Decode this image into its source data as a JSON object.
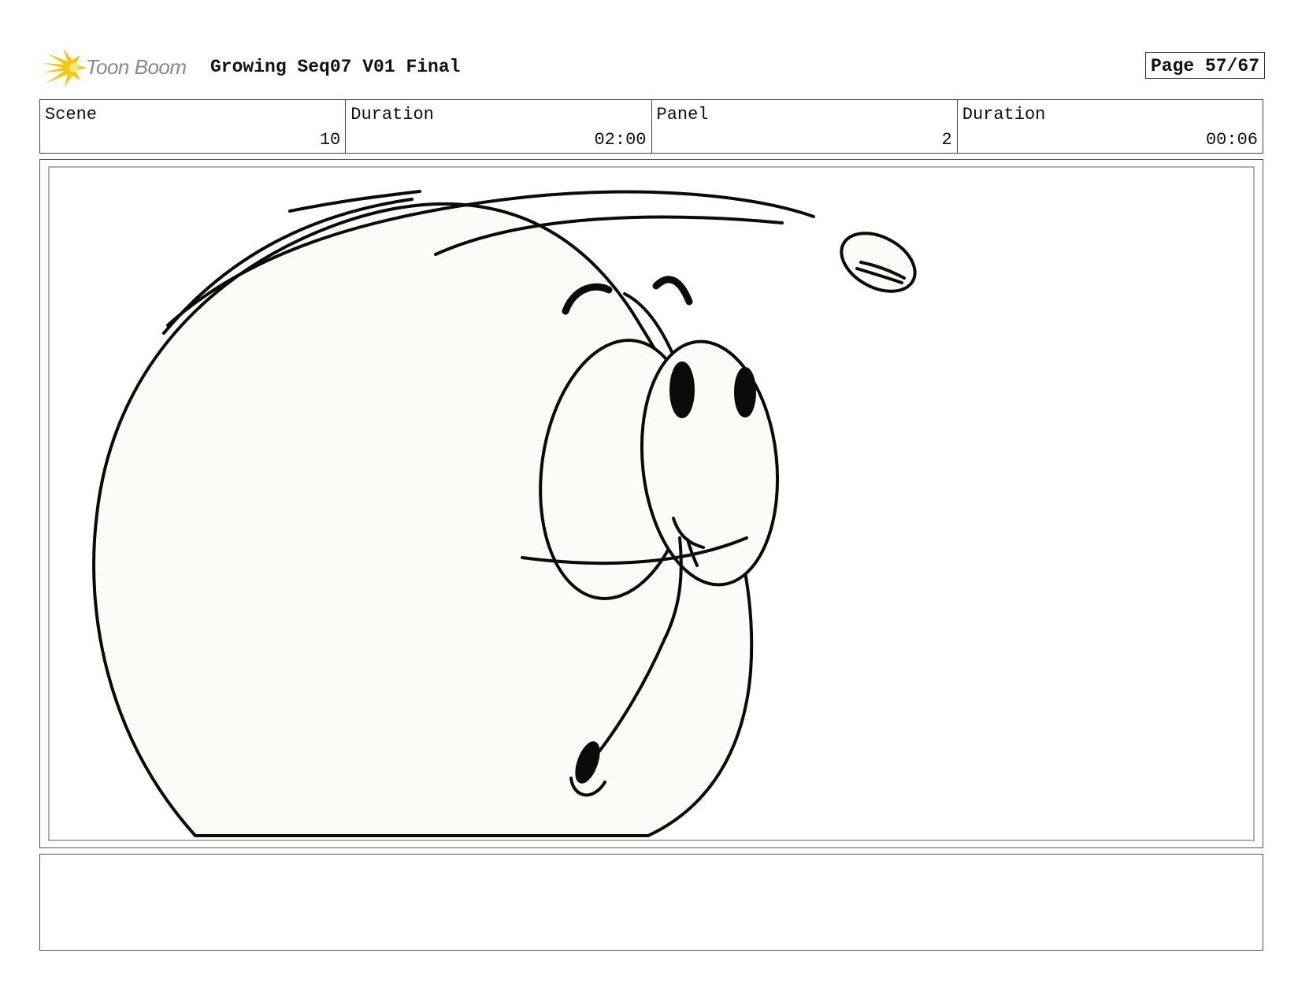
{
  "header": {
    "logo_text": "Toon Boom",
    "project_title": "Growing Seq07 V01 Final",
    "page_label": "Page 57/67"
  },
  "info": {
    "scene": {
      "label": "Scene",
      "value": "10"
    },
    "scene_duration": {
      "label": "Duration",
      "value": "02:00"
    },
    "panel": {
      "label": "Panel",
      "value": "2"
    },
    "panel_duration": {
      "label": "Duration",
      "value": "00:06"
    }
  },
  "drawing": {
    "subject": "sketch-character-face",
    "fill_color": "#fbfcf7",
    "stroke_color": "#0a0a0a",
    "logo_color": "#f5c518"
  },
  "notes": {
    "text": ""
  }
}
